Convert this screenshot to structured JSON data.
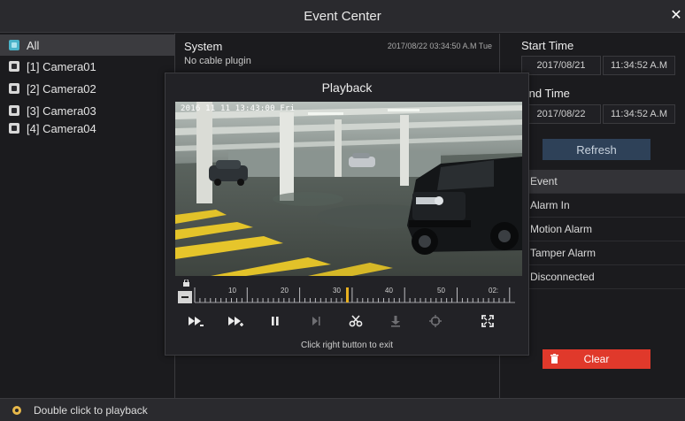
{
  "window": {
    "title": "Event Center",
    "close_icon": "close-icon"
  },
  "channels": [
    {
      "label": "All",
      "selected": true
    },
    {
      "label": "[1] Camera01",
      "selected": false
    },
    {
      "label": "[2] Camera02",
      "selected": false
    },
    {
      "label": "[3] Camera03",
      "selected": false
    },
    {
      "label": "[4] Camera04",
      "selected": false
    }
  ],
  "event": {
    "title": "System",
    "subtitle": "No cable plugin",
    "time": "2017/08/22 03:34:50 A.M Tue"
  },
  "filters": {
    "start_label": "Start Time",
    "start_date": "2017/08/21",
    "start_time": "11:34:52 A.M",
    "end_label": "End Time",
    "end_date": "2017/08/22",
    "end_time": "11:34:52 A.M",
    "refresh_label": "Refresh",
    "event_header": "Event",
    "events": [
      "Alarm In",
      "Motion Alarm",
      "Tamper Alarm",
      "Disconnected"
    ],
    "clear_label": "Clear"
  },
  "playback": {
    "title": "Playback",
    "osd": "2016 11 11  13:43:00 Fri",
    "timeline_labels": [
      "10",
      "20",
      "30",
      "40",
      "50",
      "02:"
    ],
    "hint": "Click right button to exit",
    "controls": [
      "slow-forward-icon",
      "fast-forward-icon",
      "pause-icon",
      "step-forward-icon",
      "clip-icon",
      "download-icon",
      "snapshot-icon",
      "fullscreen-icon"
    ]
  },
  "status": {
    "text": "Double click to playback"
  },
  "colors": {
    "accent": "#4ab3c9",
    "refresh_bg": "#2e4158",
    "clear_bg": "#e0392b",
    "cursor": "#e8b020"
  }
}
